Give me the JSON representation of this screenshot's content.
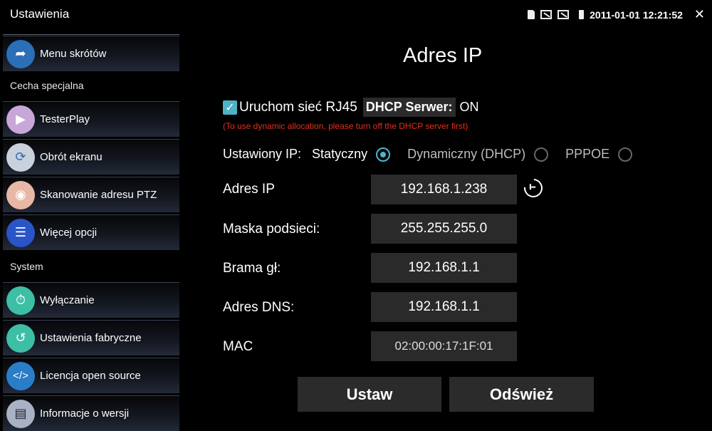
{
  "app_title": "Ustawienia",
  "status": {
    "datetime": "2011-01-01 12:21:52"
  },
  "sidebar": {
    "items": [
      {
        "label": "Menu skrótów",
        "icon": "share-arrow-icon",
        "color": "#2a6fb8"
      },
      {
        "label": "TesterPlay",
        "icon": "play-screen-icon",
        "color": "#c7a6d8"
      },
      {
        "label": "Obrót ekranu",
        "icon": "rotate-screen-icon",
        "color": "#c9d1dc"
      },
      {
        "label": "Skanowanie adresu PTZ",
        "icon": "camera-scan-icon",
        "color": "#e8b8a6"
      },
      {
        "label": "Więcej opcji",
        "icon": "list-icon",
        "color": "#2a55c8"
      },
      {
        "label": "Wyłączanie",
        "icon": "timer-icon",
        "color": "#3dbfa6"
      },
      {
        "label": "Ustawienia fabryczne",
        "icon": "factory-reset-icon",
        "color": "#3dbfa6"
      },
      {
        "label": "Licencja open source",
        "icon": "code-icon",
        "color": "#2a7ec8"
      },
      {
        "label": "Informacje o wersji",
        "icon": "film-info-icon",
        "color": "#a8b2c4"
      }
    ],
    "headers": {
      "special": "Cecha specjalna",
      "system": "System"
    }
  },
  "main": {
    "title": "Adres IP",
    "rj45": {
      "checked": true,
      "label": "Uruchom sieć RJ45",
      "dhcp_label": "DHCP Serwer:",
      "dhcp_value": "ON"
    },
    "warning": "(To use dynamic allocation, please turn off the DHCP server first)",
    "ip_mode": {
      "label": "Ustawiony IP:",
      "options": [
        "Statyczny",
        "Dynamiczny (DHCP)",
        "PPPOE"
      ],
      "selected": "Statyczny"
    },
    "fields": {
      "ip": {
        "label": "Adres IP",
        "value": "192.168.1.238"
      },
      "mask": {
        "label": "Maska podsieci:",
        "value": "255.255.255.0"
      },
      "gateway": {
        "label": "Brama gł:",
        "value": "192.168.1.1"
      },
      "dns": {
        "label": "Adres DNS:",
        "value": "192.168.1.1"
      },
      "mac": {
        "label": "MAC",
        "value": "02:00:00:17:1F:01"
      }
    },
    "buttons": {
      "set": "Ustaw",
      "refresh": "Odśwież"
    }
  }
}
